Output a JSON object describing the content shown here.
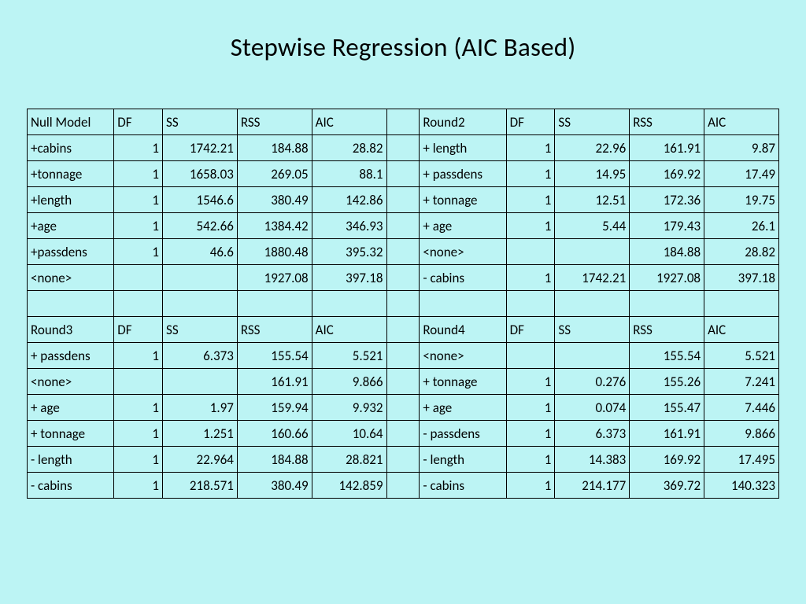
{
  "title": "Stepwise Regression (AIC Based)",
  "columns_left": [
    "DF",
    "SS",
    "RSS",
    "AIC"
  ],
  "columns_right": [
    "DF",
    "SS",
    "RSS",
    "AIC"
  ],
  "chart_data": {
    "type": "table",
    "title": "Stepwise Regression (AIC Based)",
    "blocks": [
      {
        "left_header": "Null Model",
        "right_header": "Round2",
        "left_rows": [
          {
            "term": "+cabins",
            "DF": 1,
            "SS": 1742.21,
            "RSS": 184.88,
            "AIC": 28.82
          },
          {
            "term": "+tonnage",
            "DF": 1,
            "SS": 1658.03,
            "RSS": 269.05,
            "AIC": 88.1
          },
          {
            "term": "+length",
            "DF": 1,
            "SS": 1546.6,
            "RSS": 380.49,
            "AIC": 142.86
          },
          {
            "term": "+age",
            "DF": 1,
            "SS": 542.66,
            "RSS": 1384.42,
            "AIC": 346.93
          },
          {
            "term": "+passdens",
            "DF": 1,
            "SS": 46.6,
            "RSS": 1880.48,
            "AIC": 395.32
          },
          {
            "term": "<none>",
            "DF": "",
            "SS": "",
            "RSS": 1927.08,
            "AIC": 397.18
          }
        ],
        "right_rows": [
          {
            "term": "+ length",
            "DF": 1,
            "SS": 22.96,
            "RSS": 161.91,
            "AIC": 9.87
          },
          {
            "term": "+ passdens",
            "DF": 1,
            "SS": 14.95,
            "RSS": 169.92,
            "AIC": 17.49
          },
          {
            "term": "+ tonnage",
            "DF": 1,
            "SS": 12.51,
            "RSS": 172.36,
            "AIC": 19.75
          },
          {
            "term": "+ age",
            "DF": 1,
            "SS": 5.44,
            "RSS": 179.43,
            "AIC": 26.1
          },
          {
            "term": "<none>",
            "DF": "",
            "SS": "",
            "RSS": 184.88,
            "AIC": 28.82
          },
          {
            "term": "- cabins",
            "DF": 1,
            "SS": 1742.21,
            "RSS": 1927.08,
            "AIC": 397.18
          }
        ]
      },
      {
        "left_header": "Round3",
        "right_header": "Round4",
        "left_rows": [
          {
            "term": "+ passdens",
            "DF": 1,
            "SS": 6.373,
            "RSS": 155.54,
            "AIC": 5.521
          },
          {
            "term": "<none>",
            "DF": "",
            "SS": "",
            "RSS": 161.91,
            "AIC": 9.866
          },
          {
            "term": "+ age",
            "DF": 1,
            "SS": 1.97,
            "RSS": 159.94,
            "AIC": 9.932
          },
          {
            "term": "+ tonnage",
            "DF": 1,
            "SS": 1.251,
            "RSS": 160.66,
            "AIC": 10.64
          },
          {
            "term": "- length",
            "DF": 1,
            "SS": 22.964,
            "RSS": 184.88,
            "AIC": 28.821
          },
          {
            "term": "- cabins",
            "DF": 1,
            "SS": 218.571,
            "RSS": 380.49,
            "AIC": 142.859
          }
        ],
        "right_rows": [
          {
            "term": "<none>",
            "DF": "",
            "SS": "",
            "RSS": 155.54,
            "AIC": 5.521
          },
          {
            "term": "+ tonnage",
            "DF": 1,
            "SS": 0.276,
            "RSS": 155.26,
            "AIC": 7.241
          },
          {
            "term": "+ age",
            "DF": 1,
            "SS": 0.074,
            "RSS": 155.47,
            "AIC": 7.446
          },
          {
            "term": "- passdens",
            "DF": 1,
            "SS": 6.373,
            "RSS": 161.91,
            "AIC": 9.866
          },
          {
            "term": "- length",
            "DF": 1,
            "SS": 14.383,
            "RSS": 169.92,
            "AIC": 17.495
          },
          {
            "term": "- cabins",
            "DF": 1,
            "SS": 214.177,
            "RSS": 369.72,
            "AIC": 140.323
          }
        ]
      }
    ]
  }
}
